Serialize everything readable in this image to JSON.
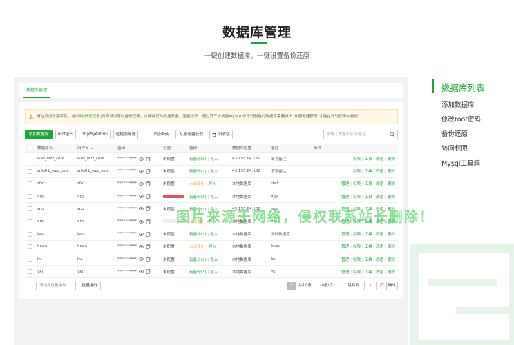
{
  "hero": {
    "title": "数据库管理",
    "subtitle": "一键创建数据库，一键设置备份还原"
  },
  "tabs": [
    {
      "label": "数据库管理"
    }
  ],
  "notice": {
    "prefix": "请在添加数据库后，务必到",
    "link": "[计划任务]",
    "middle": "页面添加定时备份任务，以确保您的数据安全。温馨提示：通过其三方或者MySQL命令行创建的数据库需要点击",
    "quote": "\"从服务器获取\"",
    "suffix": "才能在计划任务中备份"
  },
  "toolbar": {
    "add_db": "添加数据库",
    "root_pwd": "root密码",
    "phpmyadmin": "phpMyAdmin",
    "remote_server": "远程服务器",
    "sync_all": "同步所有",
    "fetch_server": "从服务器获取",
    "recycle": "回收站",
    "search_placeholder": "请输入数据库名称/备注"
  },
  "table": {
    "headers": {
      "name": "数据库名",
      "user": "用户名",
      "password": "密码",
      "capacity": "容量",
      "backup": "备份",
      "location": "数据库位置",
      "remark": "备注",
      "ops": "操作"
    },
    "rows": [
      {
        "name": "wiki_wzz_cool",
        "user": "wiki_wzz_cool",
        "password": "**********",
        "capacity": "未配置",
        "backup_status": "有备份(3)",
        "backup_import": "导入",
        "location": "43.155.64.182",
        "remark": "填写备注",
        "ops": [
          "权限",
          "工具",
          "改密",
          "删除"
        ],
        "has_manage": false
      },
      {
        "name": "wiki01_wzz_cool",
        "user": "wiki01_wzz_cool",
        "password": "**********",
        "capacity": "未配置",
        "backup_status": "有备份(3)",
        "backup_import": "导入",
        "location": "43.155.64.182",
        "remark": "填写备注",
        "ops": [
          "权限",
          "工具",
          "改密",
          "删除"
        ],
        "has_manage": false
      },
      {
        "name": "sfef",
        "user": "sfef",
        "password": "**********",
        "capacity": "未配置",
        "backup_status": "点击备份",
        "backup_import": "导入",
        "location": "本地数据库",
        "remark": "sfef",
        "ops": [
          "管理",
          "权限",
          "工具",
          "改密",
          "删除"
        ],
        "has_manage": true
      },
      {
        "name": "dgy",
        "user": "dgy",
        "password": "**********",
        "capacity": "",
        "capacity_fill": 1.0,
        "backup_status": "有备份(3)",
        "backup_import": "导入",
        "location": "本地数据库",
        "remark": "dgy",
        "ops": [
          "管理",
          "权限",
          "工具",
          "改密",
          "删除"
        ],
        "has_manage": true
      },
      {
        "name": "wzz",
        "user": "wzz",
        "password": "**********",
        "capacity": "未配置",
        "backup_status": "有备份(3)",
        "backup_import": "导入",
        "location": "43.155.64.182",
        "remark": "wzz",
        "ops": [
          "管理",
          "权限",
          "工具",
          "改密",
          "删除"
        ],
        "has_manage": true
      },
      {
        "name": "ere",
        "user": "ere",
        "password": "**********",
        "capacity": "",
        "capacity_fill": 0.0,
        "backup_status": "点击备份",
        "backup_import": "导入",
        "location": "本地数据库",
        "remark": "ere",
        "ops": [
          "管理",
          "权限",
          "工具",
          "改密",
          "删除"
        ],
        "has_manage": true
      },
      {
        "name": "test",
        "user": "test",
        "password": "**********",
        "capacity": "未配置",
        "backup_status": "有备份(3)",
        "backup_import": "导入",
        "location": "本地数据库",
        "remark": "测试数据库",
        "ops": [
          "管理",
          "权限",
          "工具",
          "改密",
          "删除"
        ],
        "has_manage": true
      },
      {
        "name": "hoou",
        "user": "hoou",
        "password": "**********",
        "capacity": "未配置",
        "backup_status": "点击备份",
        "backup_import": "导入",
        "location": "本地数据库",
        "remark": "hoou",
        "ops": [
          "管理",
          "权限",
          "工具",
          "改密",
          "删除"
        ],
        "has_manage": true
      },
      {
        "name": "ku",
        "user": "ku",
        "password": "**********",
        "capacity": "未配置",
        "backup_status": "有备份(3)",
        "backup_import": "导入",
        "location": "本地数据库",
        "remark": "ku",
        "ops": [
          "管理",
          "权限",
          "工具",
          "改密",
          "删除"
        ],
        "has_manage": true
      },
      {
        "name": "ykl",
        "user": "ykl",
        "password": "**********",
        "capacity": "未配置",
        "backup_status": "有备份(3)",
        "backup_import": "导入",
        "location": "本地数据库",
        "remark": "ykl",
        "ops": [
          "管理",
          "权限",
          "工具",
          "改密",
          "删除"
        ],
        "has_manage": true
      }
    ]
  },
  "footer": {
    "batch_placeholder": "请选择批量操作",
    "batch_button": "批量操作",
    "page_current": "1",
    "total": "共10条",
    "per_page": "20条/页",
    "jump_label": "跳转到",
    "jump_value": "1",
    "page_unit": "页",
    "confirm": "确认"
  },
  "side_nav": {
    "items": [
      {
        "label": "数据库列表",
        "active": true
      },
      {
        "label": "添加数据库",
        "active": false
      },
      {
        "label": "修改root密码",
        "active": false
      },
      {
        "label": "备份还原",
        "active": false
      },
      {
        "label": "访问权限",
        "active": false
      },
      {
        "label": "Mysql工具箱",
        "active": false
      }
    ]
  },
  "watermark": "图片来源于网络，侵权联系站长删除！",
  "colors": {
    "accent": "#20a53a",
    "warning": "#f0ad4e",
    "danger_bar": "#e05555"
  }
}
